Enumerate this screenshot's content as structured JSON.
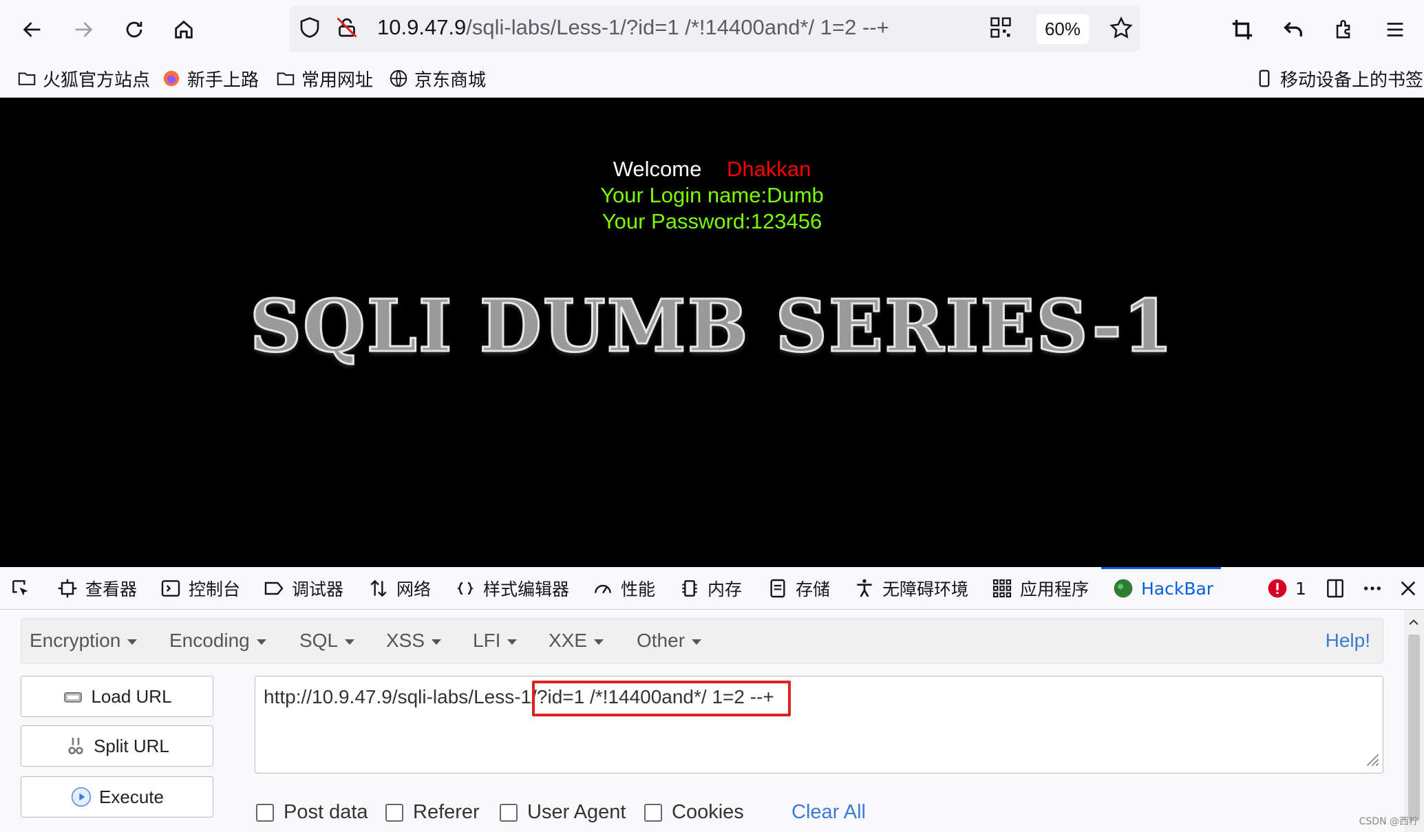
{
  "browser": {
    "url": {
      "host": "10.9.47.9",
      "path": "/sqli-labs/Less-1/?id=1 /*!14400and*/ 1=2 --+"
    },
    "zoom": "60%"
  },
  "bookmarks": [
    {
      "label": "火狐官方站点",
      "icon": "folder-icon"
    },
    {
      "label": "新手上路",
      "icon": "firefox-icon"
    },
    {
      "label": "常用网址",
      "icon": "folder-icon"
    },
    {
      "label": "京东商城",
      "icon": "globe-icon"
    }
  ],
  "mobile_bookmarks": "移动设备上的书签",
  "page": {
    "welcome": "Welcome",
    "welcome_name": "Dhakkan",
    "login_name": "Your Login name:Dumb",
    "password": "Your Password:123456",
    "title": "SQLI DUMB SERIES-1"
  },
  "devtools": {
    "tabs": [
      {
        "label": "查看器",
        "icon": "inspector-icon"
      },
      {
        "label": "控制台",
        "icon": "console-icon"
      },
      {
        "label": "调试器",
        "icon": "debugger-icon"
      },
      {
        "label": "网络",
        "icon": "network-icon"
      },
      {
        "label": "样式编辑器",
        "icon": "style-editor-icon"
      },
      {
        "label": "性能",
        "icon": "performance-icon"
      },
      {
        "label": "内存",
        "icon": "memory-icon"
      },
      {
        "label": "存储",
        "icon": "storage-icon"
      },
      {
        "label": "无障碍环境",
        "icon": "accessibility-icon"
      },
      {
        "label": "应用程序",
        "icon": "application-icon"
      },
      {
        "label": "HackBar",
        "icon": "hackbar-icon"
      }
    ],
    "error_count": "1"
  },
  "hackbar": {
    "menus": [
      "Encryption",
      "Encoding",
      "SQL",
      "XSS",
      "LFI",
      "XXE",
      "Other"
    ],
    "help": "Help!",
    "buttons": {
      "load": "Load URL",
      "split": "Split URL",
      "execute": "Execute"
    },
    "url_prefix": "http://10.9.47.9/sqli-labs/Less-1",
    "url_suffix": "/?id=1 /*!14400and*/ 1=2 --+",
    "checkboxes": [
      "Post data",
      "Referer",
      "User Agent",
      "Cookies"
    ],
    "clear_all": "Clear All"
  },
  "watermark": "CSDN @西柠",
  "colors": {
    "accent": "#0060df",
    "highlight": "#e02020",
    "login_green": "#7cfc00",
    "name_red": "#ff0000"
  }
}
